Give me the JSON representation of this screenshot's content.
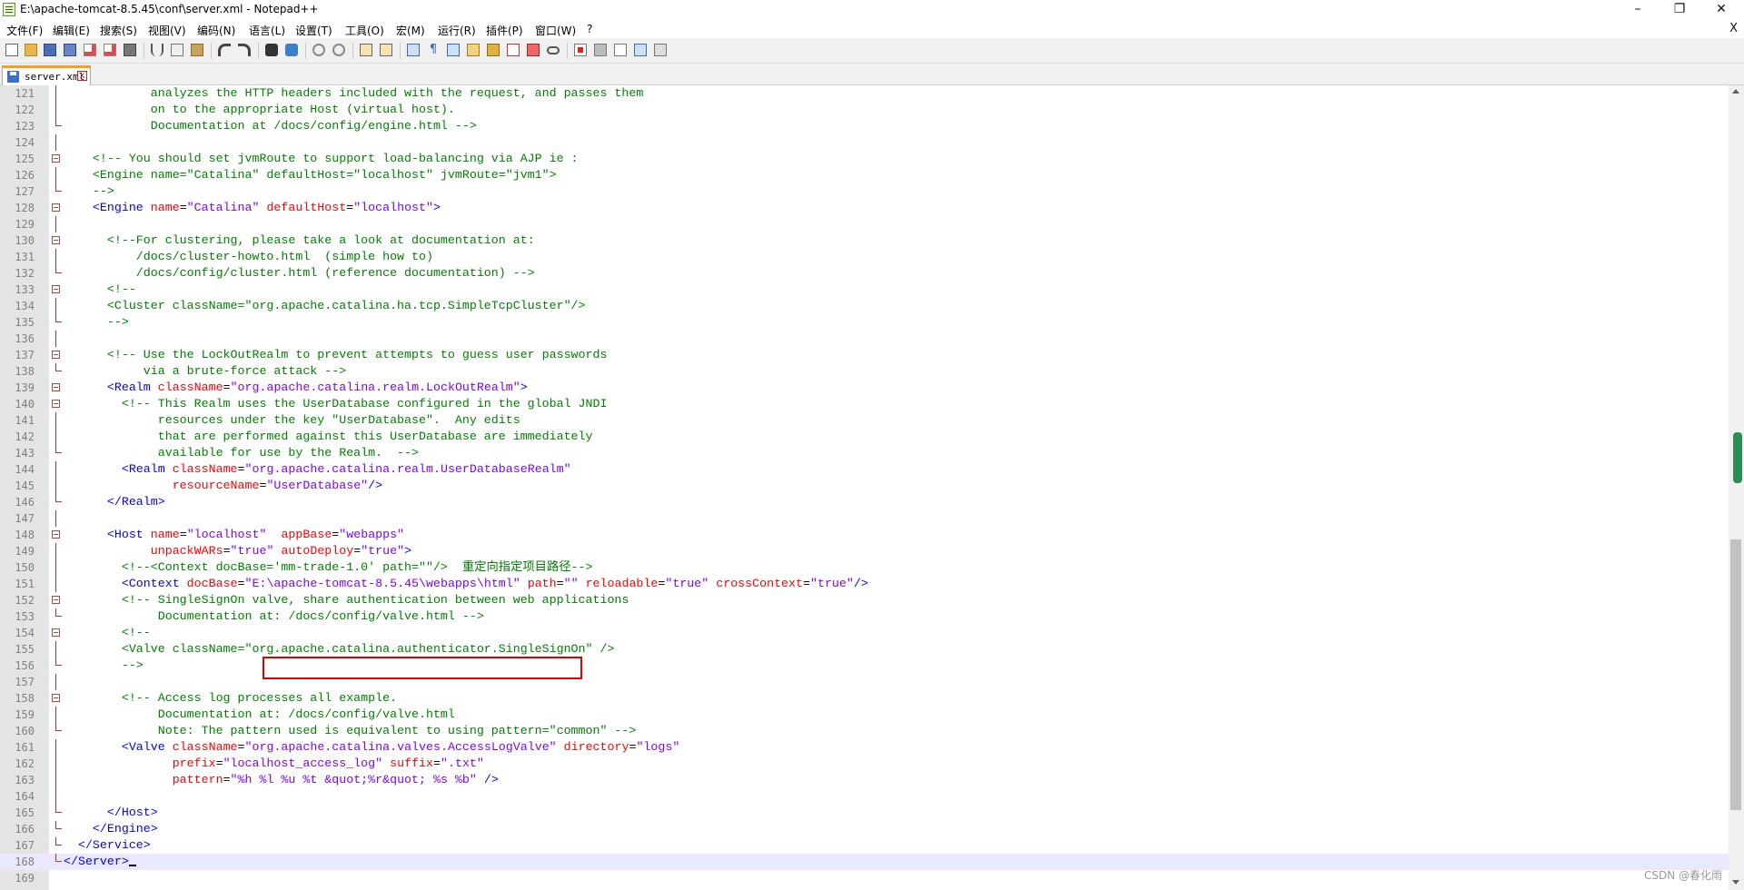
{
  "window": {
    "title": "E:\\apache-tomcat-8.5.45\\conf\\server.xml - Notepad++",
    "minimize": "–",
    "restore": "❐",
    "close": "✕"
  },
  "menu": {
    "items": [
      "文件(F)",
      "编辑(E)",
      "搜索(S)",
      "视图(V)",
      "编码(N)",
      "语言(L)",
      "设置(T)",
      "工具(O)",
      "宏(M)",
      "运行(R)",
      "插件(P)",
      "窗口(W)",
      "?"
    ],
    "close_doc": "X"
  },
  "tab": {
    "label": "server.xml",
    "close": "x"
  },
  "editor": {
    "lines": [
      {
        "n": "121",
        "fold": "line",
        "tokens": [
          [
            "c",
            "            analyzes the HTTP headers included with the request, and passes them"
          ]
        ]
      },
      {
        "n": "122",
        "fold": "line",
        "tokens": [
          [
            "c",
            "            on to the appropriate Host (virtual host)."
          ]
        ]
      },
      {
        "n": "123",
        "fold": "end",
        "tokens": [
          [
            "c",
            "            Documentation at /docs/config/engine.html -->"
          ]
        ]
      },
      {
        "n": "124",
        "fold": "line",
        "tokens": [
          [
            "p",
            ""
          ]
        ]
      },
      {
        "n": "125",
        "fold": "box",
        "tokens": [
          [
            "c",
            "    <!-- You should set jvmRoute to support load-balancing via AJP ie :"
          ]
        ]
      },
      {
        "n": "126",
        "fold": "line",
        "tokens": [
          [
            "c",
            "    <Engine name=\"Catalina\" defaultHost=\"localhost\" jvmRoute=\"jvm1\">"
          ]
        ]
      },
      {
        "n": "127",
        "fold": "end",
        "tokens": [
          [
            "c",
            "    -->"
          ]
        ]
      },
      {
        "n": "128",
        "fold": "box",
        "tokens": [
          [
            "p",
            "    "
          ],
          [
            "t",
            "<Engine"
          ],
          [
            "p",
            " "
          ],
          [
            "a",
            "name"
          ],
          [
            "p",
            "="
          ],
          [
            "s",
            "\"Catalina\""
          ],
          [
            "p",
            " "
          ],
          [
            "a",
            "defaultHost"
          ],
          [
            "p",
            "="
          ],
          [
            "s",
            "\"localhost\""
          ],
          [
            "t",
            ">"
          ]
        ]
      },
      {
        "n": "129",
        "fold": "line",
        "tokens": [
          [
            "p",
            ""
          ]
        ]
      },
      {
        "n": "130",
        "fold": "box",
        "tokens": [
          [
            "c",
            "      <!--For clustering, please take a look at documentation at:"
          ]
        ]
      },
      {
        "n": "131",
        "fold": "line",
        "tokens": [
          [
            "c",
            "          /docs/cluster-howto.html  (simple how to)"
          ]
        ]
      },
      {
        "n": "132",
        "fold": "end",
        "tokens": [
          [
            "c",
            "          /docs/config/cluster.html (reference documentation) -->"
          ]
        ]
      },
      {
        "n": "133",
        "fold": "box",
        "tokens": [
          [
            "c",
            "      <!--"
          ]
        ]
      },
      {
        "n": "134",
        "fold": "line",
        "tokens": [
          [
            "c",
            "      <Cluster className=\"org.apache.catalina.ha.tcp.SimpleTcpCluster\"/>"
          ]
        ]
      },
      {
        "n": "135",
        "fold": "end",
        "tokens": [
          [
            "c",
            "      -->"
          ]
        ]
      },
      {
        "n": "136",
        "fold": "line",
        "tokens": [
          [
            "p",
            ""
          ]
        ]
      },
      {
        "n": "137",
        "fold": "box",
        "tokens": [
          [
            "c",
            "      <!-- Use the LockOutRealm to prevent attempts to guess user passwords"
          ]
        ]
      },
      {
        "n": "138",
        "fold": "end",
        "tokens": [
          [
            "c",
            "           via a brute-force attack -->"
          ]
        ]
      },
      {
        "n": "139",
        "fold": "box",
        "tokens": [
          [
            "p",
            "      "
          ],
          [
            "t",
            "<Realm"
          ],
          [
            "p",
            " "
          ],
          [
            "a",
            "className"
          ],
          [
            "p",
            "="
          ],
          [
            "s",
            "\"org.apache.catalina.realm.LockOutRealm\""
          ],
          [
            "t",
            ">"
          ]
        ]
      },
      {
        "n": "140",
        "fold": "box",
        "tokens": [
          [
            "c",
            "        <!-- This Realm uses the UserDatabase configured in the global JNDI"
          ]
        ]
      },
      {
        "n": "141",
        "fold": "line",
        "tokens": [
          [
            "c",
            "             resources under the key \"UserDatabase\".  Any edits"
          ]
        ]
      },
      {
        "n": "142",
        "fold": "line",
        "tokens": [
          [
            "c",
            "             that are performed against this UserDatabase are immediately"
          ]
        ]
      },
      {
        "n": "143",
        "fold": "end",
        "tokens": [
          [
            "c",
            "             available for use by the Realm.  -->"
          ]
        ]
      },
      {
        "n": "144",
        "fold": "line",
        "tokens": [
          [
            "p",
            "        "
          ],
          [
            "t",
            "<Realm"
          ],
          [
            "p",
            " "
          ],
          [
            "a",
            "className"
          ],
          [
            "p",
            "="
          ],
          [
            "s",
            "\"org.apache.catalina.realm.UserDatabaseRealm\""
          ]
        ]
      },
      {
        "n": "145",
        "fold": "line",
        "tokens": [
          [
            "p",
            "               "
          ],
          [
            "a",
            "resourceName"
          ],
          [
            "p",
            "="
          ],
          [
            "s",
            "\"UserDatabase\""
          ],
          [
            "t",
            "/>"
          ]
        ]
      },
      {
        "n": "146",
        "fold": "end",
        "tokens": [
          [
            "p",
            "      "
          ],
          [
            "t",
            "</Realm>"
          ]
        ]
      },
      {
        "n": "147",
        "fold": "line",
        "tokens": [
          [
            "p",
            ""
          ]
        ]
      },
      {
        "n": "148",
        "fold": "box",
        "tokens": [
          [
            "p",
            "      "
          ],
          [
            "t",
            "<Host"
          ],
          [
            "p",
            " "
          ],
          [
            "a",
            "name"
          ],
          [
            "p",
            "="
          ],
          [
            "s",
            "\"localhost\""
          ],
          [
            "p",
            "  "
          ],
          [
            "a",
            "appBase"
          ],
          [
            "p",
            "="
          ],
          [
            "s",
            "\"webapps\""
          ]
        ]
      },
      {
        "n": "149",
        "fold": "line",
        "tokens": [
          [
            "p",
            "            "
          ],
          [
            "a",
            "unpackWARs"
          ],
          [
            "p",
            "="
          ],
          [
            "s",
            "\"true\""
          ],
          [
            "p",
            " "
          ],
          [
            "a",
            "autoDeploy"
          ],
          [
            "p",
            "="
          ],
          [
            "s",
            "\"true\""
          ],
          [
            "t",
            ">"
          ]
        ]
      },
      {
        "n": "150",
        "fold": "line",
        "tokens": [
          [
            "c",
            "        <!--<Context docBase='mm-trade-1.0' path=\"\"/>  重定向指定项目路径-->"
          ]
        ]
      },
      {
        "n": "151",
        "fold": "line",
        "tokens": [
          [
            "p",
            "        "
          ],
          [
            "t",
            "<Context"
          ],
          [
            "p",
            " "
          ],
          [
            "a",
            "docBase"
          ],
          [
            "p",
            "="
          ],
          [
            "s",
            "\"E:\\apache-tomcat-8.5.45\\webapps\\html\""
          ],
          [
            "p",
            " "
          ],
          [
            "a",
            "path"
          ],
          [
            "p",
            "="
          ],
          [
            "s",
            "\"\""
          ],
          [
            "p",
            " "
          ],
          [
            "a",
            "reloadable"
          ],
          [
            "p",
            "="
          ],
          [
            "s",
            "\"true\""
          ],
          [
            "p",
            " "
          ],
          [
            "a",
            "crossContext"
          ],
          [
            "p",
            "="
          ],
          [
            "s",
            "\"true\""
          ],
          [
            "t",
            "/>"
          ]
        ]
      },
      {
        "n": "152",
        "fold": "box",
        "tokens": [
          [
            "c",
            "        <!-- SingleSignOn valve, share authentication between web applications"
          ]
        ]
      },
      {
        "n": "153",
        "fold": "end",
        "tokens": [
          [
            "c",
            "             Documentation at: /docs/config/valve.html -->"
          ]
        ]
      },
      {
        "n": "154",
        "fold": "box",
        "tokens": [
          [
            "c",
            "        <!--"
          ]
        ]
      },
      {
        "n": "155",
        "fold": "line",
        "tokens": [
          [
            "c",
            "        <Valve className=\"org.apache.catalina.authenticator.SingleSignOn\" />"
          ]
        ]
      },
      {
        "n": "156",
        "fold": "end",
        "tokens": [
          [
            "c",
            "        -->"
          ]
        ]
      },
      {
        "n": "157",
        "fold": "line",
        "tokens": [
          [
            "p",
            ""
          ]
        ]
      },
      {
        "n": "158",
        "fold": "box",
        "tokens": [
          [
            "c",
            "        <!-- Access log processes all example."
          ]
        ]
      },
      {
        "n": "159",
        "fold": "line",
        "tokens": [
          [
            "c",
            "             Documentation at: /docs/config/valve.html"
          ]
        ]
      },
      {
        "n": "160",
        "fold": "end",
        "tokens": [
          [
            "c",
            "             Note: The pattern used is equivalent to using pattern=\"common\" -->"
          ]
        ]
      },
      {
        "n": "161",
        "fold": "line",
        "tokens": [
          [
            "p",
            "        "
          ],
          [
            "t",
            "<Valve"
          ],
          [
            "p",
            " "
          ],
          [
            "a",
            "className"
          ],
          [
            "p",
            "="
          ],
          [
            "s",
            "\"org.apache.catalina.valves.AccessLogValve\""
          ],
          [
            "p",
            " "
          ],
          [
            "a",
            "directory"
          ],
          [
            "p",
            "="
          ],
          [
            "s",
            "\"logs\""
          ]
        ]
      },
      {
        "n": "162",
        "fold": "line",
        "tokens": [
          [
            "p",
            "               "
          ],
          [
            "a",
            "prefix"
          ],
          [
            "p",
            "="
          ],
          [
            "s",
            "\"localhost_access_log\""
          ],
          [
            "p",
            " "
          ],
          [
            "a",
            "suffix"
          ],
          [
            "p",
            "="
          ],
          [
            "s",
            "\".txt\""
          ]
        ]
      },
      {
        "n": "163",
        "fold": "line",
        "tokens": [
          [
            "p",
            "               "
          ],
          [
            "a",
            "pattern"
          ],
          [
            "p",
            "="
          ],
          [
            "s",
            "\"%h %l %u %t &quot;%r&quot; %s %b\""
          ],
          [
            "p",
            " "
          ],
          [
            "t",
            "/>"
          ]
        ]
      },
      {
        "n": "164",
        "fold": "line",
        "tokens": [
          [
            "p",
            ""
          ]
        ]
      },
      {
        "n": "165",
        "fold": "end",
        "tokens": [
          [
            "p",
            "      "
          ],
          [
            "t",
            "</Host>"
          ]
        ]
      },
      {
        "n": "166",
        "fold": "end",
        "tokens": [
          [
            "p",
            "    "
          ],
          [
            "t",
            "</Engine>"
          ]
        ]
      },
      {
        "n": "167",
        "fold": "end",
        "tokens": [
          [
            "p",
            "  "
          ],
          [
            "t",
            "</Service>"
          ]
        ]
      },
      {
        "n": "168",
        "fold": "end",
        "current": true,
        "tokens": [
          [
            "t",
            "</Server>"
          ]
        ]
      },
      {
        "n": "169",
        "fold": "none",
        "tokens": [
          [
            "p",
            ""
          ]
        ]
      }
    ]
  },
  "watermark": "CSDN @春化雨",
  "colors": {
    "comment": "#008000",
    "tag": "#0000ff",
    "attribute": "#ff0000",
    "string": "#8000ff",
    "highlight_box": "#e00000",
    "current_line": "#e8e8ff"
  }
}
